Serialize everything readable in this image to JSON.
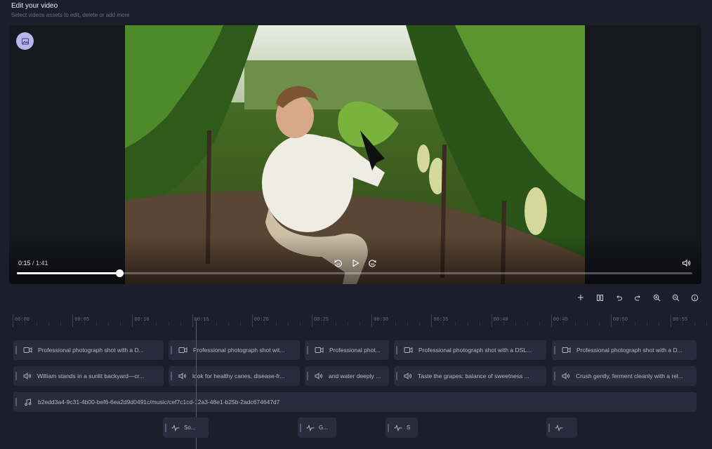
{
  "header": {
    "title": "Edit your video",
    "subtitle": "Select videos assets to edit, delete or add more"
  },
  "player": {
    "current_time": "0:15",
    "total_time": " / 1:41",
    "progress_fraction": 0.152,
    "buttons": {
      "thumbnail": "image-icon",
      "rewind": "rewind-10-icon",
      "play": "play-icon",
      "forward": "forward-10-icon",
      "volume": "volume-icon"
    }
  },
  "toolbar": [
    "add-icon",
    "split-icon",
    "undo-icon",
    "redo-icon",
    "zoom-in-icon",
    "zoom-out-icon",
    "info-icon"
  ],
  "ruler": {
    "labels": [
      "00:00",
      "00:05",
      "00:10",
      "00:15",
      "00:20",
      "00:25",
      "00:30",
      "00:35",
      "00:40",
      "00:45",
      "00:50",
      "00:55"
    ]
  },
  "playhead_time": "00:15",
  "tracks": {
    "video": [
      {
        "label": "Professional photograph shot with a D..."
      },
      {
        "label": "Professional photograph shot wit..."
      },
      {
        "label": "Professional phot..."
      },
      {
        "label": "Professional photograph shot with a DSL..."
      },
      {
        "label": "Professional photograph shot with a D..."
      }
    ],
    "voice": [
      {
        "label": "William stands in a sunlit backyard—cr..."
      },
      {
        "label": "look for healthy canes, disease-fr..."
      },
      {
        "label": "and water deeply ..."
      },
      {
        "label": "Taste the grapes: balance of sweetness ..."
      },
      {
        "label": "Crush gently, ferment cleanly with a rel..."
      }
    ],
    "music": {
      "label": "b2edd3a4-9c31-4b00-bef6-6ea2d9d0491c/music/cef7c1cd-12a3-48e1-b25b-2adc674647d7"
    },
    "sfx": [
      {
        "label": "So..."
      },
      {
        "label": "G..."
      },
      {
        "label": "S"
      },
      {
        "label": ""
      }
    ]
  },
  "colors": {
    "background": "#1d1e2c",
    "clip": "#2a2c3d",
    "playhead": "#b0345a",
    "accent": "#b9b4ec"
  }
}
